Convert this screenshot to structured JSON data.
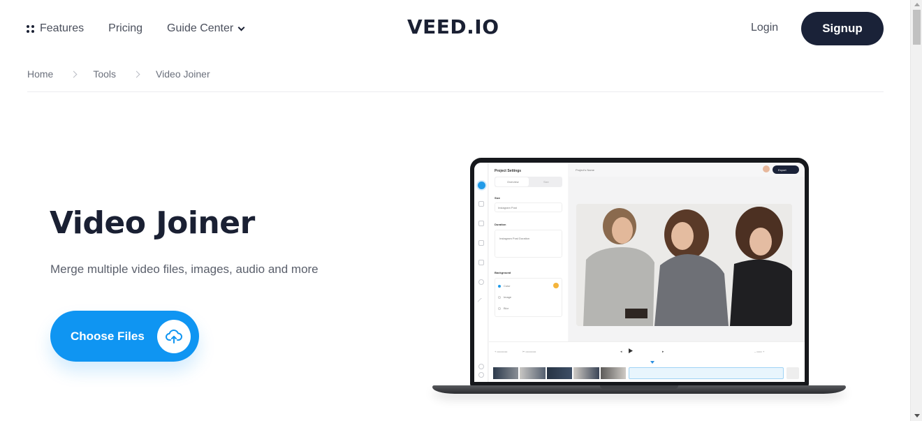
{
  "header": {
    "nav": [
      {
        "label": "Features",
        "icon": "grid-dots-icon"
      },
      {
        "label": "Pricing"
      },
      {
        "label": "Guide Center",
        "icon": "chevron-down-icon"
      }
    ],
    "logo": "VEED.IO",
    "login_label": "Login",
    "signup_label": "Signup"
  },
  "breadcrumb": [
    {
      "label": "Home"
    },
    {
      "label": "Tools"
    },
    {
      "label": "Video Joiner"
    }
  ],
  "hero": {
    "title": "Video Joiner",
    "subtitle": "Merge multiple video files, images, audio and more",
    "cta_label": "Choose Files",
    "cta_icon": "cloud-upload-icon"
  },
  "mockup": {
    "panel_title": "Project Settings",
    "tabs": [
      "Overview",
      "Size"
    ],
    "sections": [
      "Size",
      "Duration",
      "Background"
    ],
    "size_value": "Instagram Post",
    "duration_value": "Instagram Post Duration",
    "background_options": [
      "Color",
      "Image",
      "Blur"
    ],
    "project_name": "Project's Name",
    "export_label": "Export"
  },
  "colors": {
    "brand_dark": "#1a2238",
    "accent_blue": "#0f95f2"
  }
}
